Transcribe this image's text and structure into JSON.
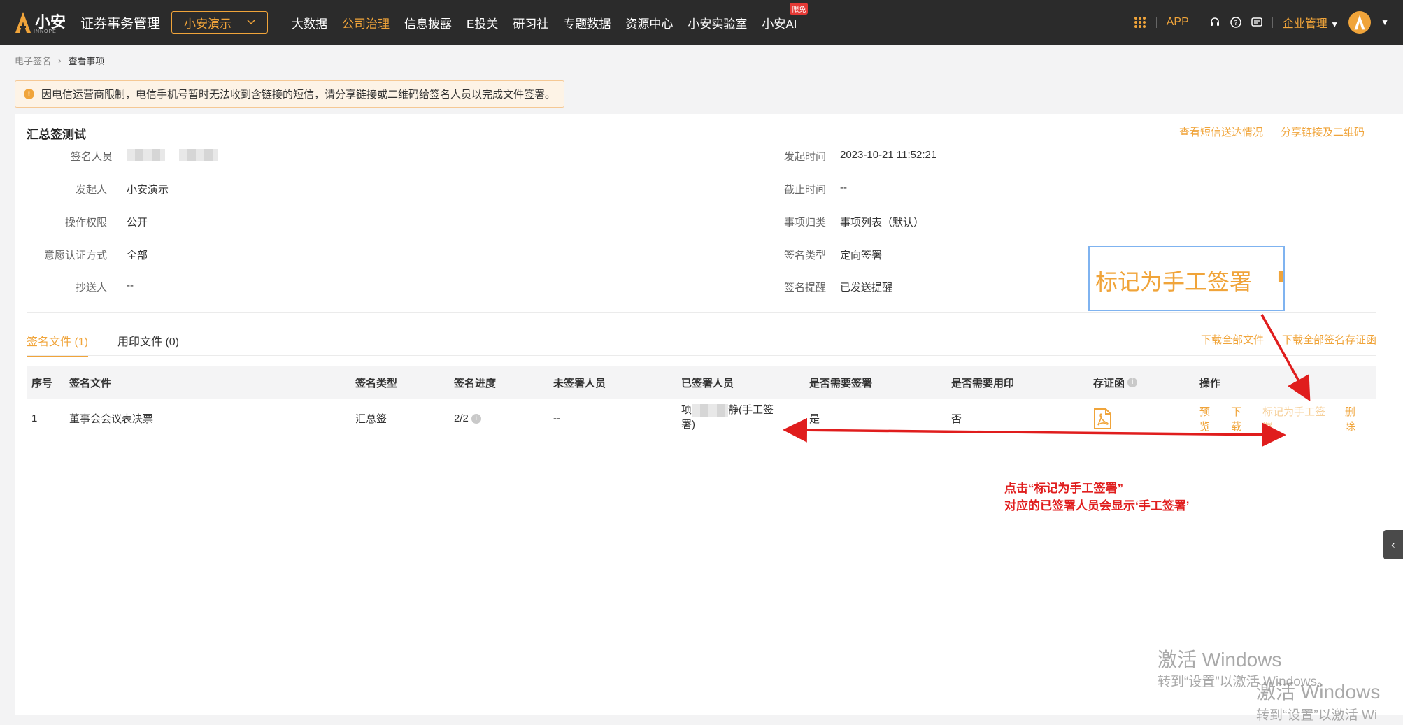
{
  "topbar": {
    "logo_text": "小安",
    "logo_sub": "INNOPE",
    "system_title": "证券事务管理",
    "company": "小安演示",
    "nav": [
      "大数据",
      "公司治理",
      "信息披露",
      "E投关",
      "研习社",
      "专题数据",
      "资源中心",
      "小安实验室",
      "小安AI"
    ],
    "nav_badge": "限免",
    "right": {
      "app": "APP",
      "enterprise": "企业管理"
    }
  },
  "breadcrumb": [
    "电子签名",
    "查看事项"
  ],
  "alert": "因电信运营商限制，电信手机号暂时无法收到含链接的短信，请分享链接或二维码给签名人员以完成文件签署。",
  "card": {
    "title": "汇总签测试",
    "links": [
      "查看短信送达情况",
      "分享链接及二维码"
    ],
    "left_info": [
      {
        "label": "签名人员",
        "value": ""
      },
      {
        "label": "发起人",
        "value": "小安演示"
      },
      {
        "label": "操作权限",
        "value": "公开"
      },
      {
        "label": "意愿认证方式",
        "value": "全部"
      },
      {
        "label": "抄送人",
        "value": "--"
      }
    ],
    "right_info": [
      {
        "label": "发起时间",
        "value": "2023-10-21 11:52:21"
      },
      {
        "label": "截止时间",
        "value": "--"
      },
      {
        "label": "事项归类",
        "value": "事项列表（默认）"
      },
      {
        "label": "签名类型",
        "value": "定向签署"
      },
      {
        "label": "签名提醒",
        "value": "已发送提醒"
      }
    ]
  },
  "tabs": [
    {
      "label": "签名文件 (1)"
    },
    {
      "label": "用印文件 (0)"
    }
  ],
  "tab_links": [
    "下载全部文件",
    "下载全部签名存证函"
  ],
  "table": {
    "headers": [
      "序号",
      "签名文件",
      "签名类型",
      "签名进度",
      "未签署人员",
      "已签署人员",
      "是否需要签署",
      "是否需要用印",
      "存证函",
      "操作"
    ],
    "rows": [
      {
        "index": "1",
        "file": "董事会会议表决票",
        "type": "汇总签",
        "progress": "2/2",
        "unsigned": "--",
        "signed_a": "项",
        "signed_b": "静(手工签",
        "signed_c": "署)",
        "need_sign": "是",
        "need_seal": "否",
        "ops": [
          "预览",
          "下载",
          "标记为手工签署",
          "删除"
        ]
      }
    ]
  },
  "annotation": {
    "zoom_text": "标记为手工签署",
    "line1": "点击“标记为手工签署”",
    "line2": "对应的已签署人员会显示‘手工签署’"
  },
  "watermarks": [
    {
      "main": "激活 Windows",
      "sub": "转到“设置”以激活 Windows。"
    },
    {
      "main": "激活 Windows",
      "sub": "转到“设置”以激活 Wi"
    }
  ],
  "colors": {
    "accent": "#f0a43a",
    "annotation": "#e01d1d",
    "topbar": "#2b2b2b"
  }
}
